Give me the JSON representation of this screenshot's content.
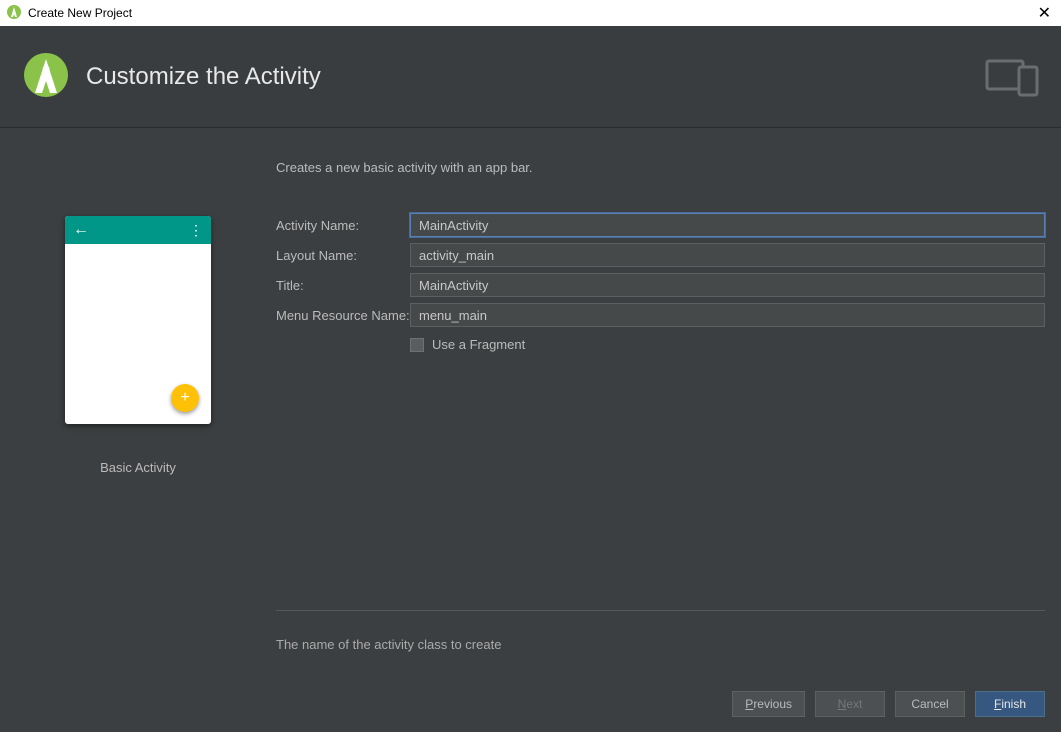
{
  "window": {
    "title": "Create New Project"
  },
  "header": {
    "title": "Customize the Activity"
  },
  "description": "Creates a new basic activity with an app bar.",
  "preview": {
    "caption": "Basic Activity"
  },
  "form": {
    "activity_name": {
      "label": "Activity Name:",
      "value": "MainActivity"
    },
    "layout_name": {
      "label": "Layout Name:",
      "value": "activity_main"
    },
    "title": {
      "label": "Title:",
      "value": "MainActivity"
    },
    "menu_resource": {
      "label": "Menu Resource Name:",
      "value": "menu_main"
    },
    "use_fragment": {
      "label": "Use a Fragment",
      "checked": false
    }
  },
  "hint": "The name of the activity class to create",
  "buttons": {
    "previous": "Previous",
    "next": "Next",
    "cancel": "Cancel",
    "finish": "Finish"
  }
}
